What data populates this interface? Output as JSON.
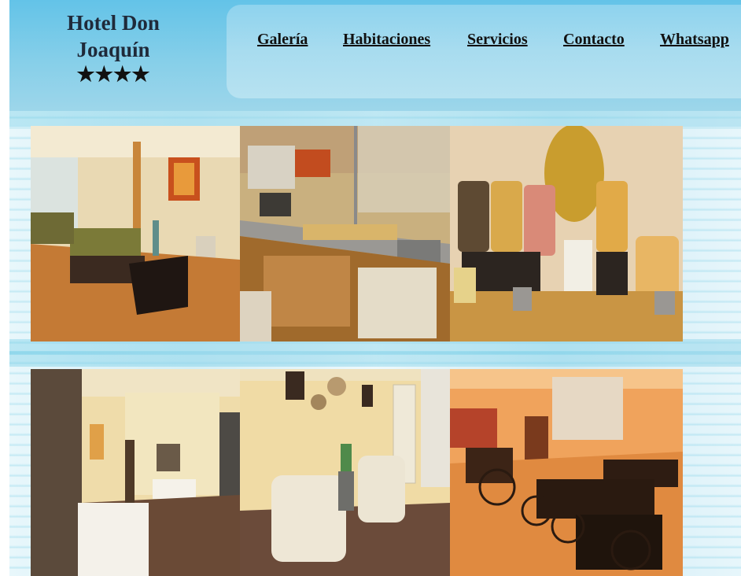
{
  "brand": {
    "name_line1": "Hotel Don",
    "name_line2": "Joaquín",
    "stars": "★★★★"
  },
  "nav": {
    "items": [
      {
        "label": "Galería"
      },
      {
        "label": "Habitaciones"
      },
      {
        "label": "Servicios"
      },
      {
        "label": "Contacto"
      },
      {
        "label": "Whatsapp"
      }
    ]
  },
  "gallery": {
    "photos": [
      {
        "subject": "lobby-lounge"
      },
      {
        "subject": "breakfast-buffet"
      },
      {
        "subject": "cereal-dispensers"
      },
      {
        "subject": "hallway"
      },
      {
        "subject": "sitting-area"
      },
      {
        "subject": "dining-room"
      }
    ]
  },
  "colors": {
    "header_blue": "#63c3e8",
    "nav_panel": "#a8dcef",
    "text_dark": "#1f2a3a"
  }
}
